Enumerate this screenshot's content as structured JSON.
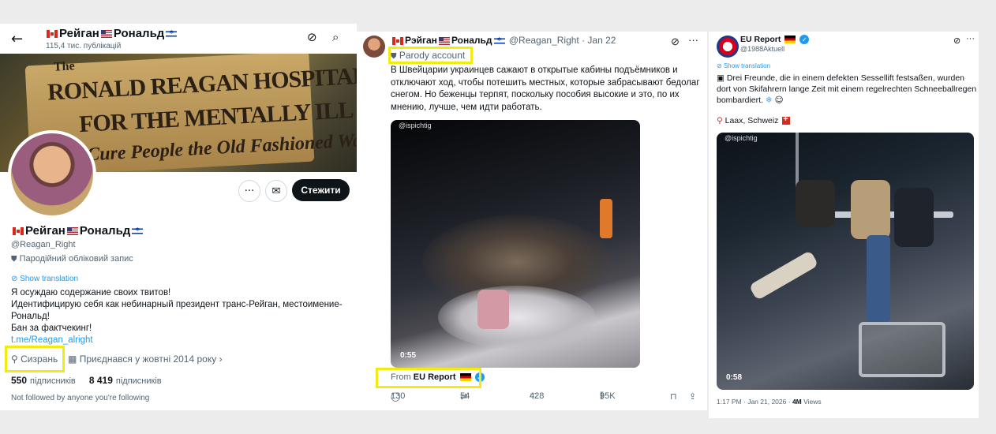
{
  "profile": {
    "name_prefix": "Рейган",
    "name_suffix": "Рональд",
    "posts_count": "115,4 тис. публікацій",
    "follow_label": "Стежити",
    "handle": "@Reagan_Right",
    "parody_label": "Пародійний обліковий запис",
    "show_translation": "Show translation",
    "bio": [
      "Я осуждаю содержание своих твитов!",
      "Идентифицирую себя как небинарный президент транс-Рейган, местоимение-Рональд!",
      "Бан за фактчекинг!"
    ],
    "link": "t.me/Reagan_alright",
    "location": "Сизрань",
    "joined": "Приєднався у жовтні 2014 року",
    "following_count": "550",
    "following_label": "підписників",
    "followers_count": "8 419",
    "followers_label": "підписників",
    "not_followed": "Not followed by anyone you're following",
    "banner_lines": [
      "RONALD REAGAN HOSPITAL",
      "FOR THE MENTALLY ILL",
      "Cure People the Old Fashioned Way"
    ],
    "banner_prefix": "The"
  },
  "tweet1": {
    "name_prefix": "Рэйган",
    "name_suffix": "Рональд",
    "handle_date": "@Reagan_Right · Jan 22",
    "parody": "Parody account",
    "text": "В Швейцарии украинцев сажают в открытые кабины подъёмников и отключают ход, чтобы потешить местных, которые забрасывают бедолаг снегом. Но беженцы терпят, поскольку пособия высокие и это, по их мнению, лучше, чем идти работать.",
    "video_tag": "@ispichtig",
    "video_time": "0:55",
    "from_label": "From",
    "from_account": "EU Report",
    "replies": "130",
    "reposts": "54",
    "likes": "428",
    "views": "95K"
  },
  "tweet2": {
    "name": "EU Report",
    "handle": "@1988Aktuell",
    "show_translation": "Show translation",
    "text": "Drei Freunde, die in einem defekten Sessellift festsaßen, wurden dort von Skifahrern lange Zeit mit einem regelrechten Schneeballregen bombardiert.",
    "location": "Laax, Schweiz",
    "video_tag": "@ispichtig",
    "video_time": "0:58",
    "date": "1:17 PM · Jan 21, 2026 ·",
    "views_count": "4M",
    "views_label": "Views"
  },
  "colors": {
    "accent": "#1d9bf0",
    "highlight": "#f2ea14",
    "text": "#0f1419",
    "muted": "#536471"
  },
  "icons": [
    "back-arrow-icon",
    "grok-icon",
    "search-icon",
    "more-icon",
    "message-icon",
    "location-icon",
    "calendar-icon",
    "chevron-right-icon",
    "reply-icon",
    "repost-icon",
    "like-icon",
    "views-icon",
    "bookmark-icon",
    "share-icon",
    "verified-icon"
  ]
}
